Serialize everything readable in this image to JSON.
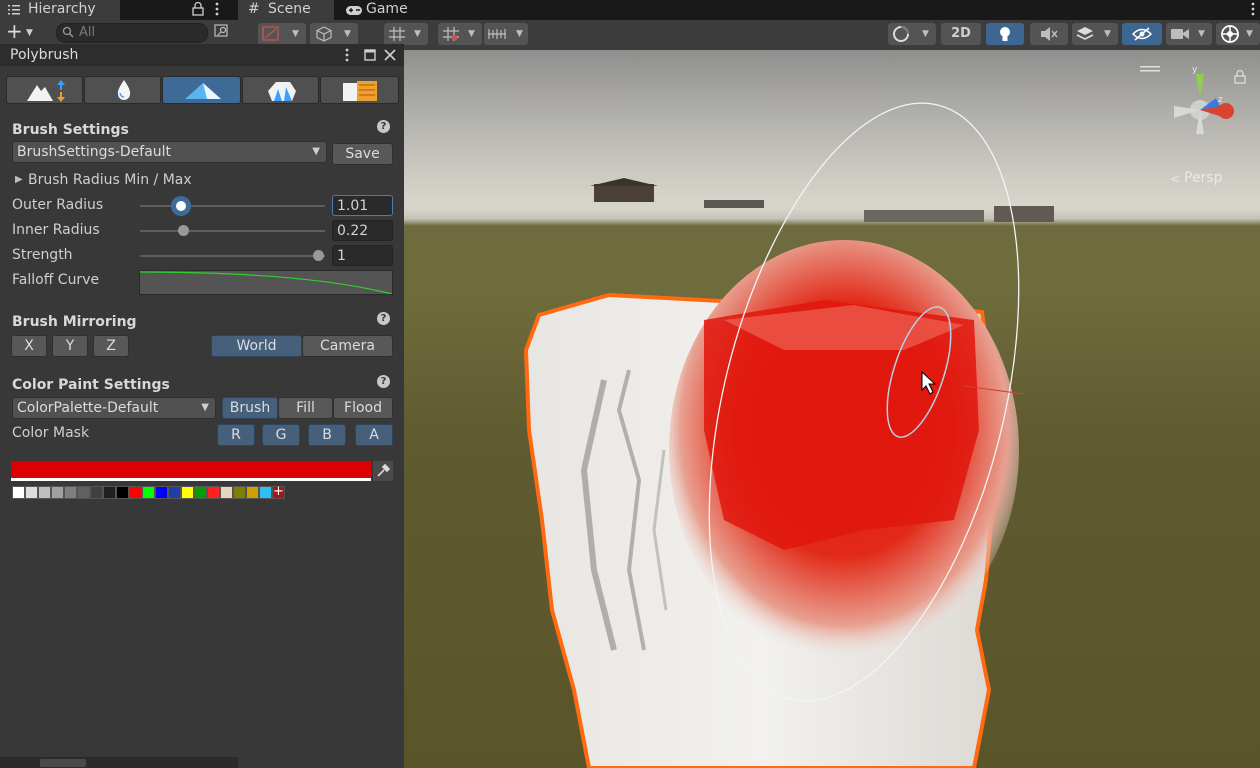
{
  "hierarchy": {
    "tab_title": "Hierarchy",
    "search_placeholder": "All",
    "add_label": "+"
  },
  "scene": {
    "tabs": [
      {
        "label": "Scene",
        "active": true
      },
      {
        "label": "Game",
        "active": false
      }
    ],
    "toolbar": {
      "mode_2d": "2D"
    },
    "gizmo_label": "Persp"
  },
  "polybrush": {
    "window_title": "Polybrush",
    "mode_tabs": [
      {
        "name": "sculpt",
        "selected": false
      },
      {
        "name": "smooth",
        "selected": false
      },
      {
        "name": "paint-vertex-colors",
        "selected": true
      },
      {
        "name": "scatter-prefabs",
        "selected": false
      },
      {
        "name": "paint-textures",
        "selected": false
      }
    ],
    "brush_settings": {
      "header": "Brush Settings",
      "preset": "BrushSettings-Default",
      "save_label": "Save",
      "radius_foldout": "Brush Radius Min / Max",
      "outer_radius_label": "Outer Radius",
      "outer_radius_value": "1.01",
      "outer_radius_fraction": 0.22,
      "inner_radius_label": "Inner Radius",
      "inner_radius_value": "0.22",
      "inner_radius_fraction": 0.22,
      "strength_label": "Strength",
      "strength_value": "1",
      "strength_fraction": 1.0,
      "falloff_label": "Falloff Curve"
    },
    "mirroring": {
      "header": "Brush Mirroring",
      "axes": [
        "X",
        "Y",
        "Z"
      ],
      "spaces": [
        {
          "label": "World",
          "selected": true
        },
        {
          "label": "Camera",
          "selected": false
        }
      ]
    },
    "color_paint": {
      "header": "Color Paint Settings",
      "palette": "ColorPalette-Default",
      "modes": [
        {
          "label": "Brush",
          "selected": true
        },
        {
          "label": "Fill",
          "selected": false
        },
        {
          "label": "Flood",
          "selected": false
        }
      ],
      "mask_label": "Color Mask",
      "mask_channels": [
        "R",
        "G",
        "B",
        "A"
      ],
      "current_color": "#dd0000",
      "palette_colors": [
        "#ffffff",
        "#dedede",
        "#bfbfbf",
        "#a0a0a0",
        "#7f7f7f",
        "#606060",
        "#404040",
        "#202020",
        "#000000",
        "#ff0000",
        "#00ff00",
        "#0000ff",
        "#1f3fa8",
        "#ffff00",
        "#00a000",
        "#ff2020",
        "#e6d6c0",
        "#808000",
        "#d0a000",
        "#30c0f0"
      ],
      "add_color": "+"
    }
  }
}
